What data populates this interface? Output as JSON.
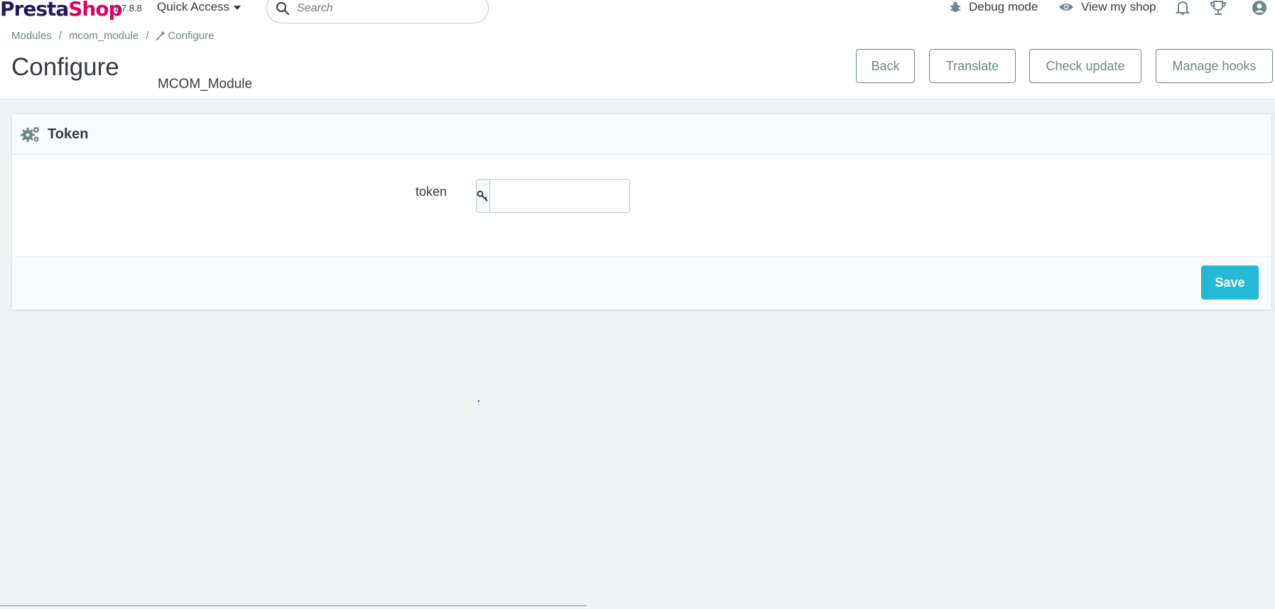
{
  "header": {
    "logo_part1": "Presta",
    "logo_part2": "Shop",
    "version": "1.7.8.8",
    "quick_access_label": "Quick Access",
    "search_placeholder": "Search",
    "debug_mode_label": "Debug mode",
    "view_shop_label": "View my shop"
  },
  "breadcrumb": {
    "items": [
      "Modules",
      "mcom_module",
      "Configure"
    ],
    "separator": "/"
  },
  "page": {
    "title": "Configure",
    "module_name": "MCOM_Module"
  },
  "toolbar": {
    "back_label": "Back",
    "translate_label": "Translate",
    "check_update_label": "Check update",
    "manage_hooks_label": "Manage hooks"
  },
  "panel": {
    "heading": "Token",
    "field_label": "token",
    "field_value": "",
    "save_label": "Save"
  },
  "colors": {
    "brand_primary": "#251b5b",
    "brand_accent": "#df0067",
    "save_button": "#25b9d7",
    "background": "#eff1f2"
  },
  "icons": [
    "search-icon",
    "debug-icon",
    "eye-icon",
    "bell-icon",
    "trophy-icon",
    "user-icon",
    "wrench-icon",
    "gears-icon",
    "key-icon"
  ]
}
